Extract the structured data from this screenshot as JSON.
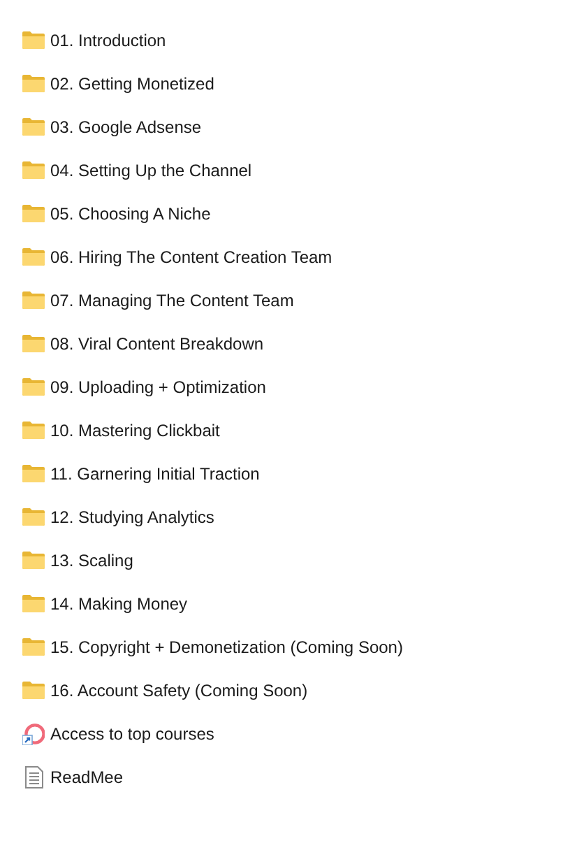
{
  "items": [
    {
      "kind": "folder",
      "name": "01. Introduction"
    },
    {
      "kind": "folder",
      "name": "02. Getting Monetized"
    },
    {
      "kind": "folder",
      "name": "03. Google Adsense"
    },
    {
      "kind": "folder",
      "name": "04. Setting Up the Channel"
    },
    {
      "kind": "folder",
      "name": "05. Choosing A Niche"
    },
    {
      "kind": "folder",
      "name": "06. Hiring The Content Creation Team"
    },
    {
      "kind": "folder",
      "name": "07. Managing The Content Team"
    },
    {
      "kind": "folder",
      "name": "08. Viral Content Breakdown"
    },
    {
      "kind": "folder",
      "name": "09. Uploading + Optimization"
    },
    {
      "kind": "folder",
      "name": "10. Mastering Clickbait"
    },
    {
      "kind": "folder",
      "name": "11. Garnering Initial Traction"
    },
    {
      "kind": "folder",
      "name": "12. Studying Analytics"
    },
    {
      "kind": "folder",
      "name": "13. Scaling"
    },
    {
      "kind": "folder",
      "name": "14. Making Money"
    },
    {
      "kind": "folder",
      "name": "15. Copyright + Demonetization (Coming Soon)"
    },
    {
      "kind": "folder",
      "name": "16. Account Safety (Coming Soon)"
    },
    {
      "kind": "shortcut",
      "name": "Access to top courses"
    },
    {
      "kind": "document",
      "name": "ReadMee"
    }
  ]
}
